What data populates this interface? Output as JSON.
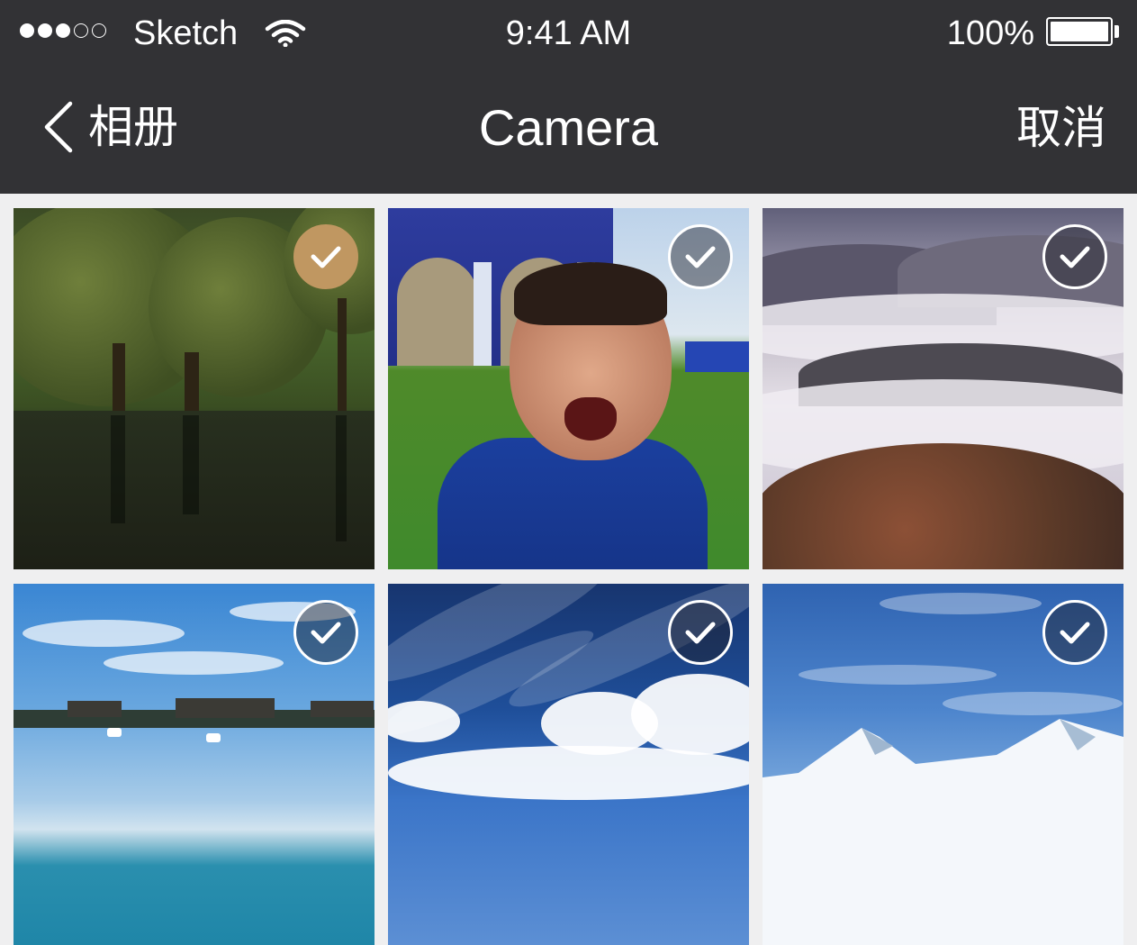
{
  "status_bar": {
    "carrier": "Sketch",
    "time": "9:41 AM",
    "battery_percent": "100%",
    "signal_bars_filled": 3,
    "signal_bars_total": 5
  },
  "nav": {
    "back_label": "相册",
    "title": "Camera",
    "cancel_label": "取消"
  },
  "colors": {
    "bar_background": "#323235",
    "page_background": "#efeff0",
    "selected_check": "#c09761"
  },
  "photos": [
    {
      "subject": "trees-by-water",
      "selected": true
    },
    {
      "subject": "laughing-child",
      "selected": false
    },
    {
      "subject": "misty-mountains",
      "selected": false
    },
    {
      "subject": "lake-pavilion",
      "selected": false
    },
    {
      "subject": "blue-sky-clouds",
      "selected": false
    },
    {
      "subject": "snow-mountains",
      "selected": false
    }
  ]
}
